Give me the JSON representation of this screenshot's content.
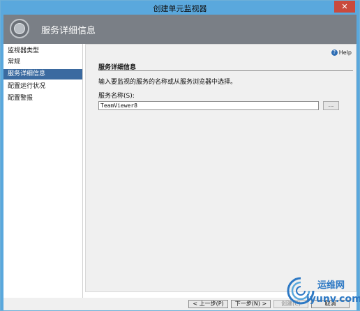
{
  "window": {
    "title": "创建单元监视器",
    "close_label": "✕"
  },
  "header": {
    "title": "服务详细信息"
  },
  "sidebar": {
    "items": [
      {
        "label": "监视器类型",
        "active": false
      },
      {
        "label": "常规",
        "active": false
      },
      {
        "label": "服务详细信息",
        "active": true
      },
      {
        "label": "配置运行状况",
        "active": false
      },
      {
        "label": "配置警报",
        "active": false
      }
    ]
  },
  "content": {
    "help_label": "Help",
    "section_title": "服务详细信息",
    "description": "输入要监视的服务的名称或从服务浏览器中选择。",
    "service_name_label": "服务名称(S):",
    "service_name_value": "TeamViewer8",
    "browse_label": "..."
  },
  "footer": {
    "prev_label": "< 上一步(P)",
    "next_label": "下一步(N) >",
    "create_label": "创建(C)",
    "cancel_label": "取消"
  },
  "watermark": {
    "cn_text": "运维网",
    "en_text": "iyunv.com"
  },
  "colors": {
    "titlebar": "#5aa8dd",
    "header": "#7a7f86",
    "nav_active": "#3b6aa0",
    "close": "#c94a3d",
    "watermark": "#2c78c4"
  }
}
